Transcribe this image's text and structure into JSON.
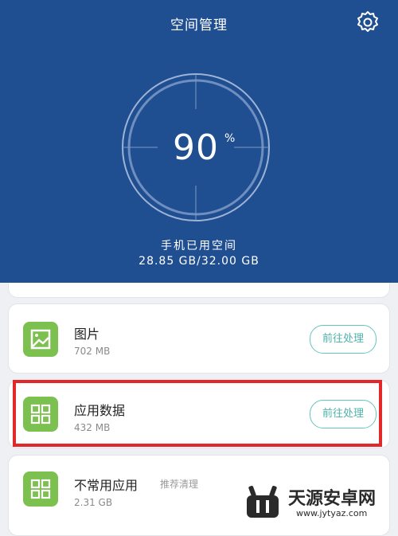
{
  "header": {
    "title": "空间管理",
    "percent_value": "90",
    "percent_sign": "%",
    "used_label": "手机已用空间",
    "used_value": "28.85 GB/32.00 GB",
    "usage_fraction": 0.9,
    "settings_icon": "gear-icon"
  },
  "items": [
    {
      "name": "图片",
      "size": "702 MB",
      "button": "前往处理",
      "icon": "image-icon"
    },
    {
      "name": "应用数据",
      "size": "432 MB",
      "button": "前往处理",
      "icon": "grid-apps-icon"
    },
    {
      "name": "不常用应用",
      "tag": "推荐清理",
      "size": "2.31 GB",
      "icon": "grid-apps-icon"
    }
  ],
  "watermark": {
    "text": "天源安卓网",
    "url": "www.jytyaz.com"
  },
  "colors": {
    "header_bg": "#1f4e91",
    "icon_green": "#7cc04f",
    "button_teal": "#4fb3aa",
    "highlight_red": "#e3282a"
  }
}
